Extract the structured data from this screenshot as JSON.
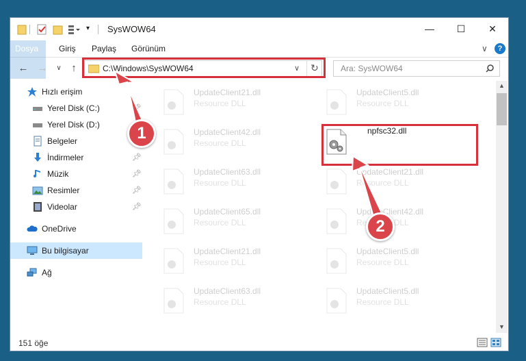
{
  "window": {
    "title": "SysWOW64",
    "minimize": "—",
    "maximize": "☐",
    "close": "✕"
  },
  "ribbon": {
    "tabs": [
      "Dosya",
      "Giriş",
      "Paylaş",
      "Görünüm"
    ],
    "expand": "∨",
    "help": "?"
  },
  "address": {
    "path": "C:\\Windows\\SysWOW64",
    "dropdown": "∨",
    "refresh": "↻"
  },
  "search": {
    "placeholder": "Ara: SysWOW64",
    "icon": "search-icon"
  },
  "nav": {
    "back": "←",
    "forward": "→",
    "recent": "∨",
    "up": "↑"
  },
  "sidebar": {
    "items": [
      {
        "label": "Hızlı erişim",
        "icon": "star-icon"
      },
      {
        "label": "Yerel Disk (C:)",
        "icon": "drive-icon",
        "pinned": "true"
      },
      {
        "label": "Yerel Disk (D:)",
        "icon": "drive-icon",
        "pinned": "true"
      },
      {
        "label": "Belgeler",
        "icon": "documents-icon",
        "pinned": "true"
      },
      {
        "label": "İndirmeler",
        "icon": "download-icon",
        "pinned": "true"
      },
      {
        "label": "Müzik",
        "icon": "music-icon",
        "pinned": "true"
      },
      {
        "label": "Resimler",
        "icon": "pictures-icon",
        "pinned": "true"
      },
      {
        "label": "Videolar",
        "icon": "video-icon",
        "pinned": "true"
      },
      {
        "label": "OneDrive",
        "icon": "cloud-icon"
      },
      {
        "label": "Bu bilgisayar",
        "icon": "computer-icon",
        "selected": "true"
      },
      {
        "label": "Ağ",
        "icon": "network-icon"
      }
    ]
  },
  "files": [
    {
      "name": "UpdateClient21.dll",
      "type": "Resource DLL"
    },
    {
      "name": "UpdateClient5.dll",
      "type": "Resource DLL"
    },
    {
      "name": "UpdateClient42.dll",
      "type": "Resource DLL"
    },
    {
      "name": "npfsc32.dll",
      "type": ""
    },
    {
      "name": "UpdateClient63.dll",
      "type": "Resource DLL"
    },
    {
      "name": "UpdateClient21.dll",
      "type": "Resource DLL"
    },
    {
      "name": "UpdateClient65.dll",
      "type": "Resource DLL"
    },
    {
      "name": "UpdateClient42.dll",
      "type": "Resource DLL"
    },
    {
      "name": "UpdateClient21.dll",
      "type": "Resource DLL"
    },
    {
      "name": "UpdateClient5.dll",
      "type": "Resource DLL"
    },
    {
      "name": "UpdateClient63.dll",
      "type": "Resource DLL"
    },
    {
      "name": "UpdateClient5.dll",
      "type": "Resource DLL"
    }
  ],
  "status": {
    "count": "151 öğe"
  },
  "annotations": {
    "marker1": "1",
    "marker2": "2",
    "color": "#d6313a"
  }
}
